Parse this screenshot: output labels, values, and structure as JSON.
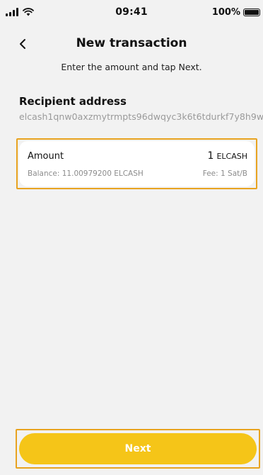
{
  "status_bar": {
    "time": "09:41",
    "battery": "100%"
  },
  "header": {
    "title": "New transaction",
    "subtitle": "Enter the amount and tap Next."
  },
  "recipient": {
    "label": "Recipient address",
    "address": "elcash1qnw0axzmytrmpts96dwqyc3k6t6tdurkf7y8h9w"
  },
  "amount": {
    "label": "Amount",
    "value": "1",
    "unit": "ELCASH",
    "balance": "Balance: 11.00979200 ELCASH",
    "fee": "Fee: 1 Sat/B"
  },
  "actions": {
    "next_label": "Next"
  },
  "colors": {
    "accent": "#f5c518",
    "highlight": "#e8a320",
    "background": "#f2f2f2"
  }
}
